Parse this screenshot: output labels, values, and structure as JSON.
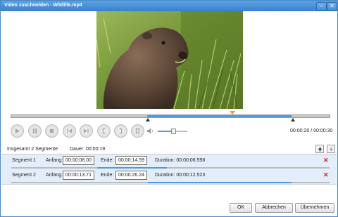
{
  "window": {
    "title": "Video zuschneiden - Wildlife.mp4",
    "minimize_glyph": "‒",
    "close_glyph": "✕"
  },
  "player": {
    "time_display": "00:00:20 / 00:00:30",
    "playhead_fraction": 0.69,
    "selection_start_fraction": 0.43,
    "selection_end_fraction": 0.88,
    "volume_fraction": 0.45
  },
  "segments_panel": {
    "summary": "Insgesamt 2 Segmente",
    "duration_text": "Dauer: 00:00:19",
    "segments": [
      {
        "name": "Segment 1",
        "start_label": "Anfang:",
        "start": "00:00:08.00",
        "end_label": "Ende:",
        "end": "00:00:14.59",
        "duration": "Duration: 00:00:06.598",
        "fill_start_fraction": 0.27,
        "fill_end_fraction": 0.49
      },
      {
        "name": "Segment 2",
        "start_label": "Anfang:",
        "start": "00:00:13.71",
        "end_label": "Ende:",
        "end": "00:00:26.24",
        "duration": "Duration: 00:00:12.523",
        "fill_start_fraction": 0.43,
        "fill_end_fraction": 0.88
      }
    ]
  },
  "buttons": {
    "ok": "OK",
    "cancel": "Abbrechen",
    "apply": "Übernehmen"
  },
  "colors": {
    "title_bar": "#4a8ed6",
    "accent": "#4f9be0",
    "playhead": "#f39a1e",
    "delete": "#d0201a",
    "row_bg": "#e3eefa"
  }
}
